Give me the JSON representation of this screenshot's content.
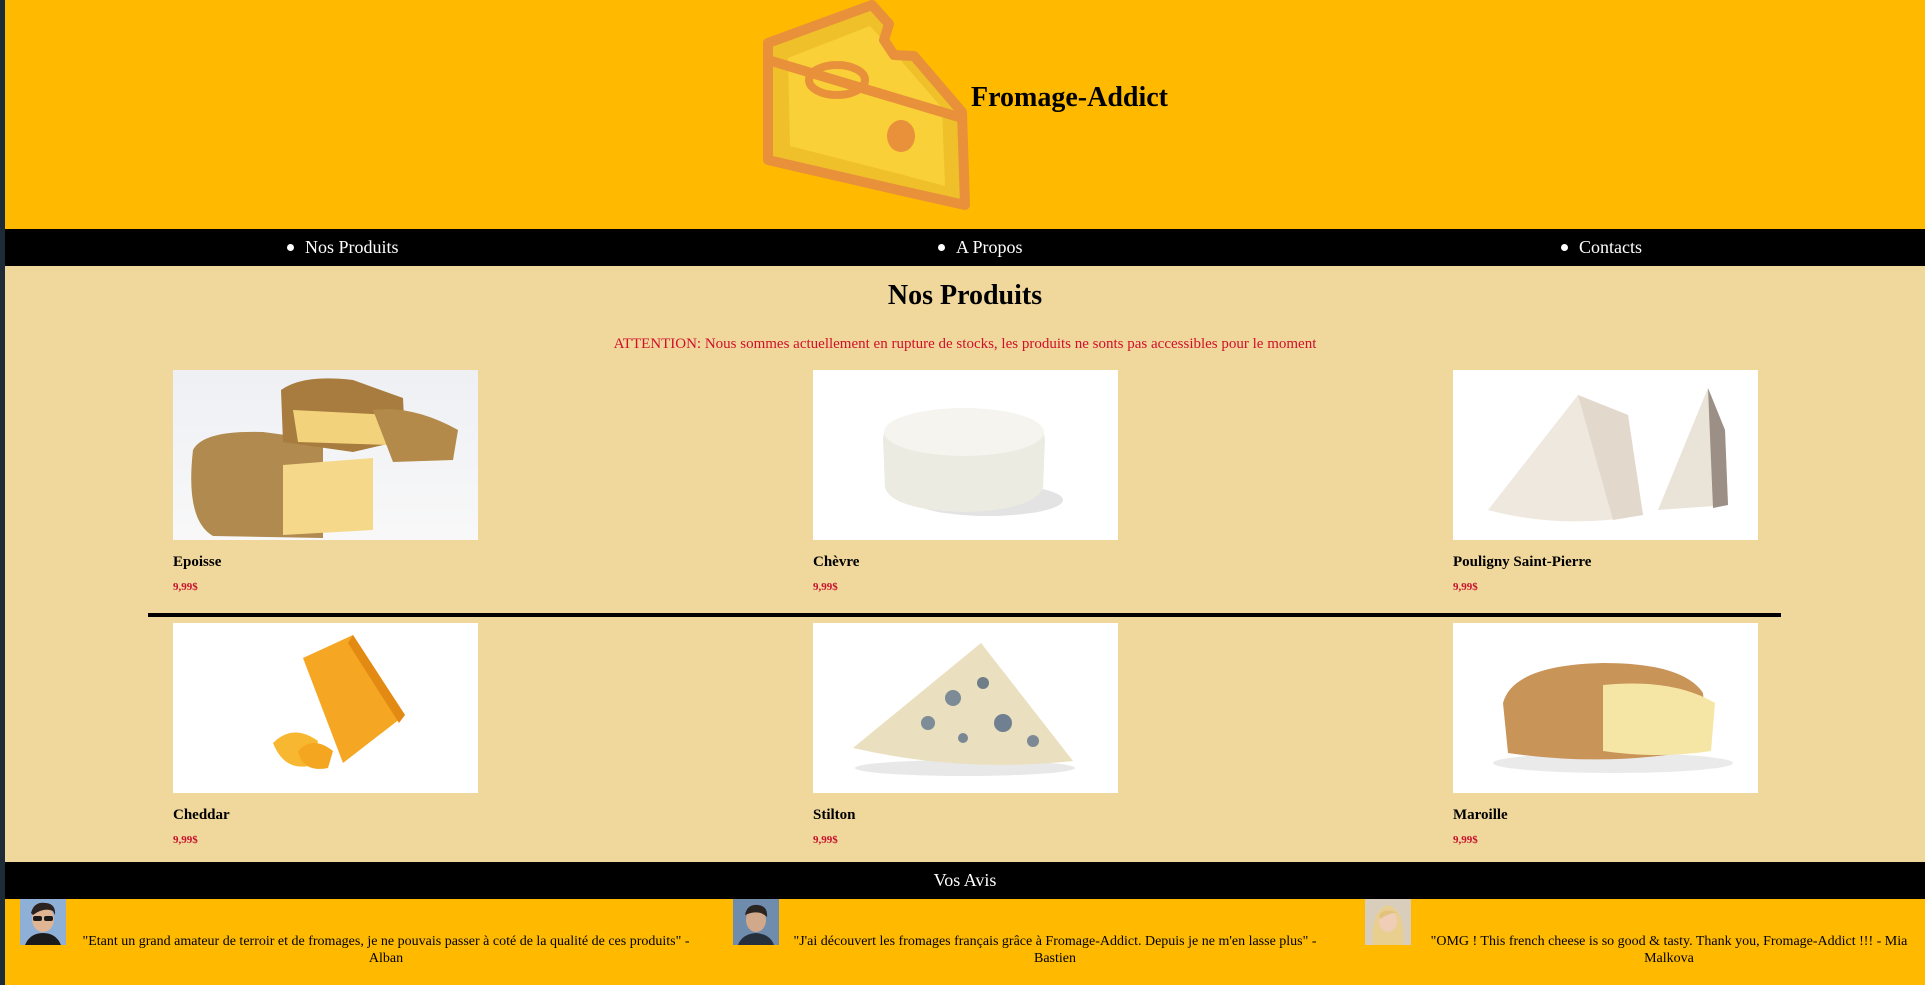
{
  "brand": {
    "name": "Fromage-Addict",
    "logo_icon": "cheese-icon"
  },
  "nav": {
    "items": [
      {
        "label": "Nos Produits"
      },
      {
        "label": "A Propos"
      },
      {
        "label": "Contacts"
      }
    ]
  },
  "products": {
    "title": "Nos Produits",
    "warning": "ATTENTION: Nous sommes actuellement en rupture de stocks, les produits ne sonts pas accessibles pour le moment",
    "items": [
      {
        "name": "Epoisse",
        "price": "9,99$"
      },
      {
        "name": "Chèvre",
        "price": "9,99$"
      },
      {
        "name": "Pouligny Saint-Pierre",
        "price": "9,99$"
      },
      {
        "name": "Cheddar",
        "price": "9,99$"
      },
      {
        "name": "Stilton",
        "price": "9,99$"
      },
      {
        "name": "Maroille",
        "price": "9,99$"
      }
    ]
  },
  "reviews": {
    "title": "Vos Avis",
    "items": [
      {
        "text": "\"Etant un grand amateur de terroir et de fromages, je ne pouvais passer à coté de la qualité de ces produits\" - Alban"
      },
      {
        "text": "\"J'ai découvert les fromages français grâce à Fromage-Addict. Depuis je ne m'en lasse plus\" - Bastien"
      },
      {
        "text": "\"OMG ! This french cheese is so good & tasty. Thank you, Fromage-Addict !!! - Mia Malkova"
      }
    ]
  },
  "colors": {
    "header": "#ffba00",
    "nav": "#000000",
    "main": "#f0d89c",
    "warning": "#d0102a",
    "price": "#c8102e"
  }
}
